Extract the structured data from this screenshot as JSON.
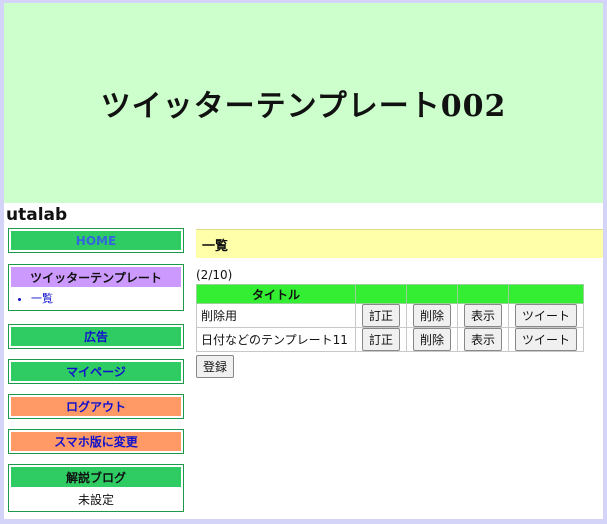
{
  "banner": {
    "title": "ツイッターテンプレート002"
  },
  "site": {
    "name": "utalab"
  },
  "sidebar": {
    "home": "HOME",
    "template_box": {
      "title": "ツイッターテンプレート",
      "items": [
        "一覧"
      ]
    },
    "ad": "広告",
    "mypage": "マイページ",
    "logout": "ログアウト",
    "smartphone": "スマホ版に変更",
    "blog_box": {
      "title": "解説ブログ",
      "value": "未設定"
    }
  },
  "main": {
    "section_title": "一覧",
    "count": "(2/10)",
    "table": {
      "headers": [
        "タイトル",
        "",
        "",
        "",
        ""
      ],
      "rows": [
        {
          "title": "削除用"
        },
        {
          "title": "日付などのテンプレート11"
        }
      ]
    },
    "actions": {
      "edit": "訂正",
      "delete": "削除",
      "view": "表示",
      "tweet": "ツイート"
    },
    "register": "登録"
  },
  "colors": {
    "banner_bg": "#ccffcc",
    "menu_green": "#2ecc63",
    "menu_orange": "#ff9966",
    "section_yellow": "#ffffaa",
    "table_header": "#33ee33"
  }
}
